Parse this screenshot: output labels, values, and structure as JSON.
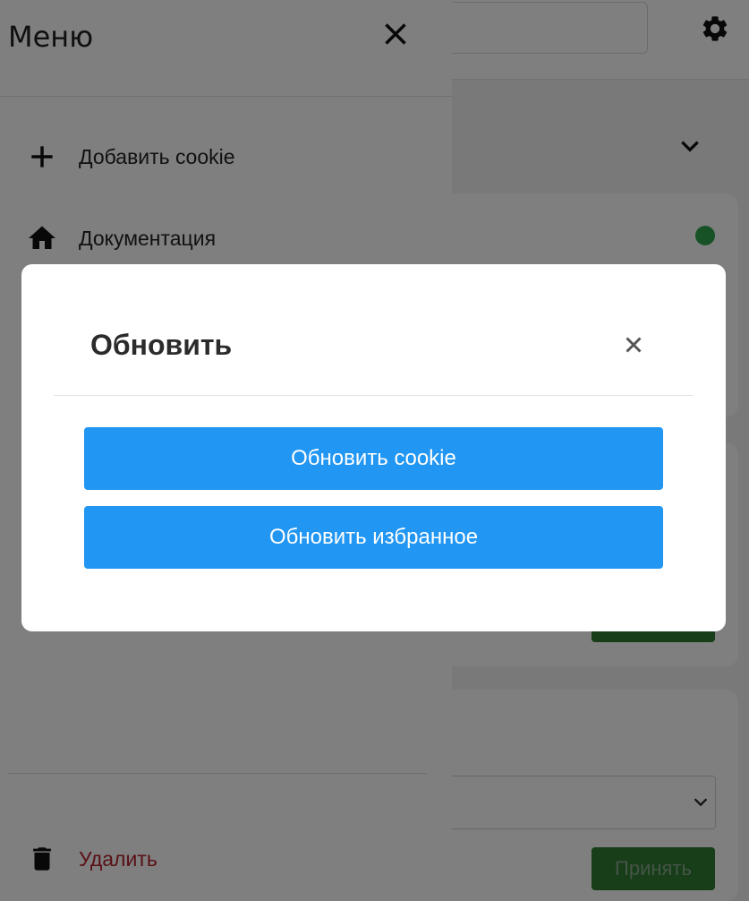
{
  "background_app": {
    "accept_label": "Принять",
    "status_color": "#2ea44f",
    "accept_color": "#2e7d32"
  },
  "drawer": {
    "title": "Меню",
    "items": [
      {
        "label": "Добавить cookie",
        "icon": "plus-icon"
      },
      {
        "label": "Документация",
        "icon": "home-icon"
      }
    ],
    "delete": {
      "label": "Удалить",
      "icon": "trash-icon",
      "color": "#b3212c"
    }
  },
  "modal": {
    "title": "Обновить",
    "close_icon": "close-icon",
    "buttons": [
      {
        "label": "Обновить cookie"
      },
      {
        "label": "Обновить избранное"
      }
    ],
    "button_color": "#2196f3"
  }
}
